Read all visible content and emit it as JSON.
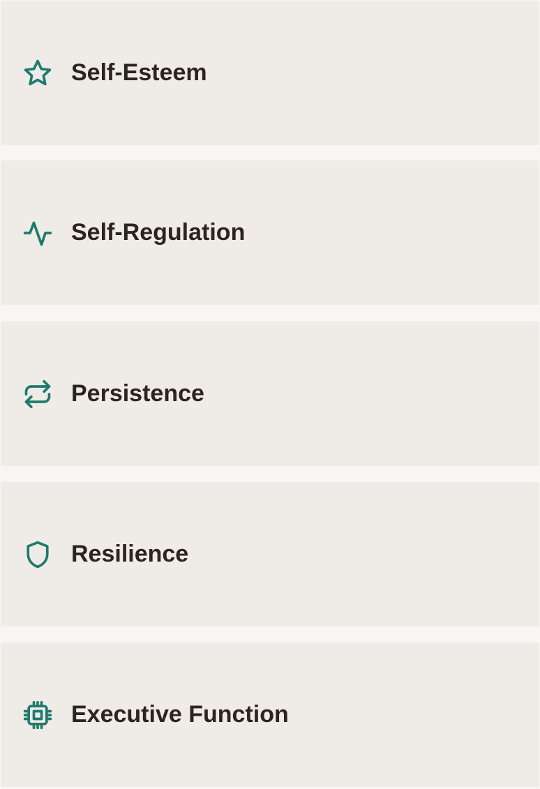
{
  "theme": {
    "accent": "#1f7a6e",
    "card_background": "#efebe6",
    "page_background": "#f8f6f2",
    "text_color": "#2b2420"
  },
  "items": [
    {
      "label": "Self-Esteem",
      "icon": "star-icon"
    },
    {
      "label": "Self-Regulation",
      "icon": "activity-icon"
    },
    {
      "label": "Persistence",
      "icon": "repeat-icon"
    },
    {
      "label": "Resilience",
      "icon": "shield-icon"
    },
    {
      "label": "Executive Function",
      "icon": "cpu-icon"
    }
  ]
}
